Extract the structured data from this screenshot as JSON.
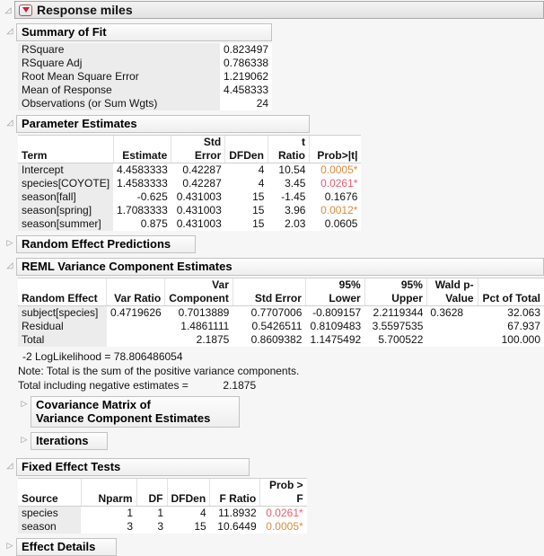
{
  "report": {
    "title": "Response miles"
  },
  "summary_of_fit": {
    "title": "Summary of Fit",
    "rows": [
      {
        "label": "RSquare",
        "value": "0.823497"
      },
      {
        "label": "RSquare Adj",
        "value": "0.786338"
      },
      {
        "label": "Root Mean Square Error",
        "value": "1.219062"
      },
      {
        "label": "Mean of Response",
        "value": "4.458333"
      },
      {
        "label": "Observations (or Sum Wgts)",
        "value": "24"
      }
    ]
  },
  "parameter_estimates": {
    "title": "Parameter Estimates",
    "columns": [
      "Term",
      "Estimate",
      "Std Error",
      "DFDen",
      "t Ratio",
      "Prob>|t|"
    ],
    "rows": [
      {
        "term": "Intercept",
        "estimate": "4.4583333",
        "std_error": "0.42287",
        "dfden": "4",
        "t_ratio": "10.54",
        "prob": "0.0005*",
        "prob_color": "orange"
      },
      {
        "term": "species[COYOTE]",
        "estimate": "1.4583333",
        "std_error": "0.42287",
        "dfden": "4",
        "t_ratio": "3.45",
        "prob": "0.0261*",
        "prob_color": "red"
      },
      {
        "term": "season[fall]",
        "estimate": "-0.625",
        "std_error": "0.431003",
        "dfden": "15",
        "t_ratio": "-1.45",
        "prob": "0.1676"
      },
      {
        "term": "season[spring]",
        "estimate": "1.7083333",
        "std_error": "0.431003",
        "dfden": "15",
        "t_ratio": "3.96",
        "prob": "0.0012*",
        "prob_color": "orange"
      },
      {
        "term": "season[summer]",
        "estimate": "0.875",
        "std_error": "0.431003",
        "dfden": "15",
        "t_ratio": "2.03",
        "prob": "0.0605"
      }
    ]
  },
  "random_effect_predictions": {
    "title": "Random Effect Predictions"
  },
  "reml": {
    "title": "REML Variance Component Estimates",
    "columns": [
      "Random Effect",
      "Var Ratio",
      "Var\nComponent",
      "Std Error",
      "95% Lower",
      "95% Upper",
      "Wald p-\nValue",
      "Pct of Total"
    ],
    "rows": [
      {
        "effect": "subject[species]",
        "var_ratio": "0.4719626",
        "var_component": "0.7013889",
        "std_error": "0.7707006",
        "lower": "-0.809157",
        "upper": "2.2119344",
        "wald_p": "0.3628",
        "pct": "32.063"
      },
      {
        "effect": "Residual",
        "var_ratio": "",
        "var_component": "1.4861111",
        "std_error": "0.5426511",
        "lower": "0.8109483",
        "upper": "3.5597535",
        "wald_p": "",
        "pct": "67.937"
      },
      {
        "effect": "Total",
        "var_ratio": "",
        "var_component": "2.1875",
        "std_error": "0.8609382",
        "lower": "1.1475492",
        "upper": "5.700522",
        "wald_p": "",
        "pct": "100.000"
      }
    ],
    "loglik_label": "-2 LogLikelihood =",
    "loglik_value": "78.806486054",
    "note": "Note: Total is the sum of the positive variance components.",
    "total_line_label": "Total including negative estimates =",
    "total_line_value": "2.1875",
    "covariance_title_line1": "Covariance Matrix of",
    "covariance_title_line2": "Variance Component Estimates",
    "iterations_title": "Iterations"
  },
  "fixed_effect_tests": {
    "title": "Fixed Effect Tests",
    "columns": [
      "Source",
      "Nparm",
      "DF",
      "DFDen",
      "F Ratio",
      "Prob > F"
    ],
    "rows": [
      {
        "source": "species",
        "nparm": "1",
        "df": "1",
        "dfden": "4",
        "f_ratio": "11.8932",
        "prob": "0.0261*",
        "prob_color": "red"
      },
      {
        "source": "season",
        "nparm": "3",
        "df": "3",
        "dfden": "15",
        "f_ratio": "10.6449",
        "prob": "0.0005*",
        "prob_color": "orange"
      }
    ]
  },
  "effect_details": {
    "title": "Effect Details"
  },
  "icons": {
    "open_triangle": "◿",
    "closed_triangle": "▷"
  },
  "colors": {
    "sig_orange": "#de8a39",
    "sig_red": "#ee5a6e",
    "red_triangle": "#cf2030"
  }
}
